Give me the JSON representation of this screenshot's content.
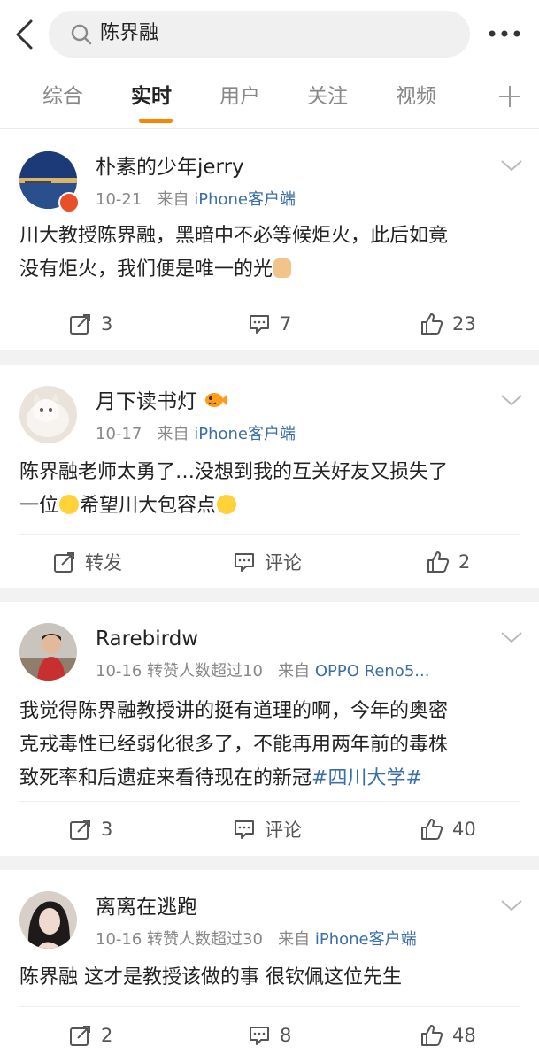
{
  "search": {
    "query": "陈界融"
  },
  "tabs": [
    {
      "label": "综合"
    },
    {
      "label": "实时"
    },
    {
      "label": "用户"
    },
    {
      "label": "关注"
    },
    {
      "label": "视频"
    }
  ],
  "colors": {
    "accent": "#ff8200",
    "link": "#3b6fa8"
  },
  "posts": [
    {
      "username": "朴素的少年jerry",
      "date": "10-21",
      "meta_extra": "",
      "source_prefix": "来自",
      "source": "iPhone客户端",
      "text_line1": "川大教授陈界融，黑暗中不必等候炬火，此后如竟",
      "text_line2": "没有炬火，我们便是唯一的光",
      "repost": "3",
      "comment": "7",
      "like": "23"
    },
    {
      "username": "月下读书灯",
      "date": "10-17",
      "meta_extra": "",
      "source_prefix": "来自",
      "source": "iPhone客户端",
      "text_line1": "陈界融老师太勇了…没想到我的互关好友又损失了",
      "text_line2a": "一位",
      "text_line2b": "希望川大包容点",
      "repost": "转发",
      "comment": "评论",
      "like": "2"
    },
    {
      "username": "Rarebirdw",
      "date": "10-16",
      "meta_extra": "转赞人数超过10",
      "source_prefix": "来自",
      "source": "OPPO Reno5...",
      "text_line1": "我觉得陈界融教授讲的挺有道理的啊，今年的奥密",
      "text_line2": "克戎毒性已经弱化很多了，不能再用两年前的毒株",
      "text_line3": "致死率和后遗症来看待现在的新冠",
      "hashtag": "#四川大学#",
      "repost": "3",
      "comment": "评论",
      "like": "40"
    },
    {
      "username": "离离在逃跑",
      "date": "10-16",
      "meta_extra": "转赞人数超过30",
      "source_prefix": "来自",
      "source": "iPhone客户端",
      "text_line1": "陈界融 这才是教授该做的事 很钦佩这位先生",
      "repost": "2",
      "comment": "8",
      "like": "48"
    }
  ]
}
